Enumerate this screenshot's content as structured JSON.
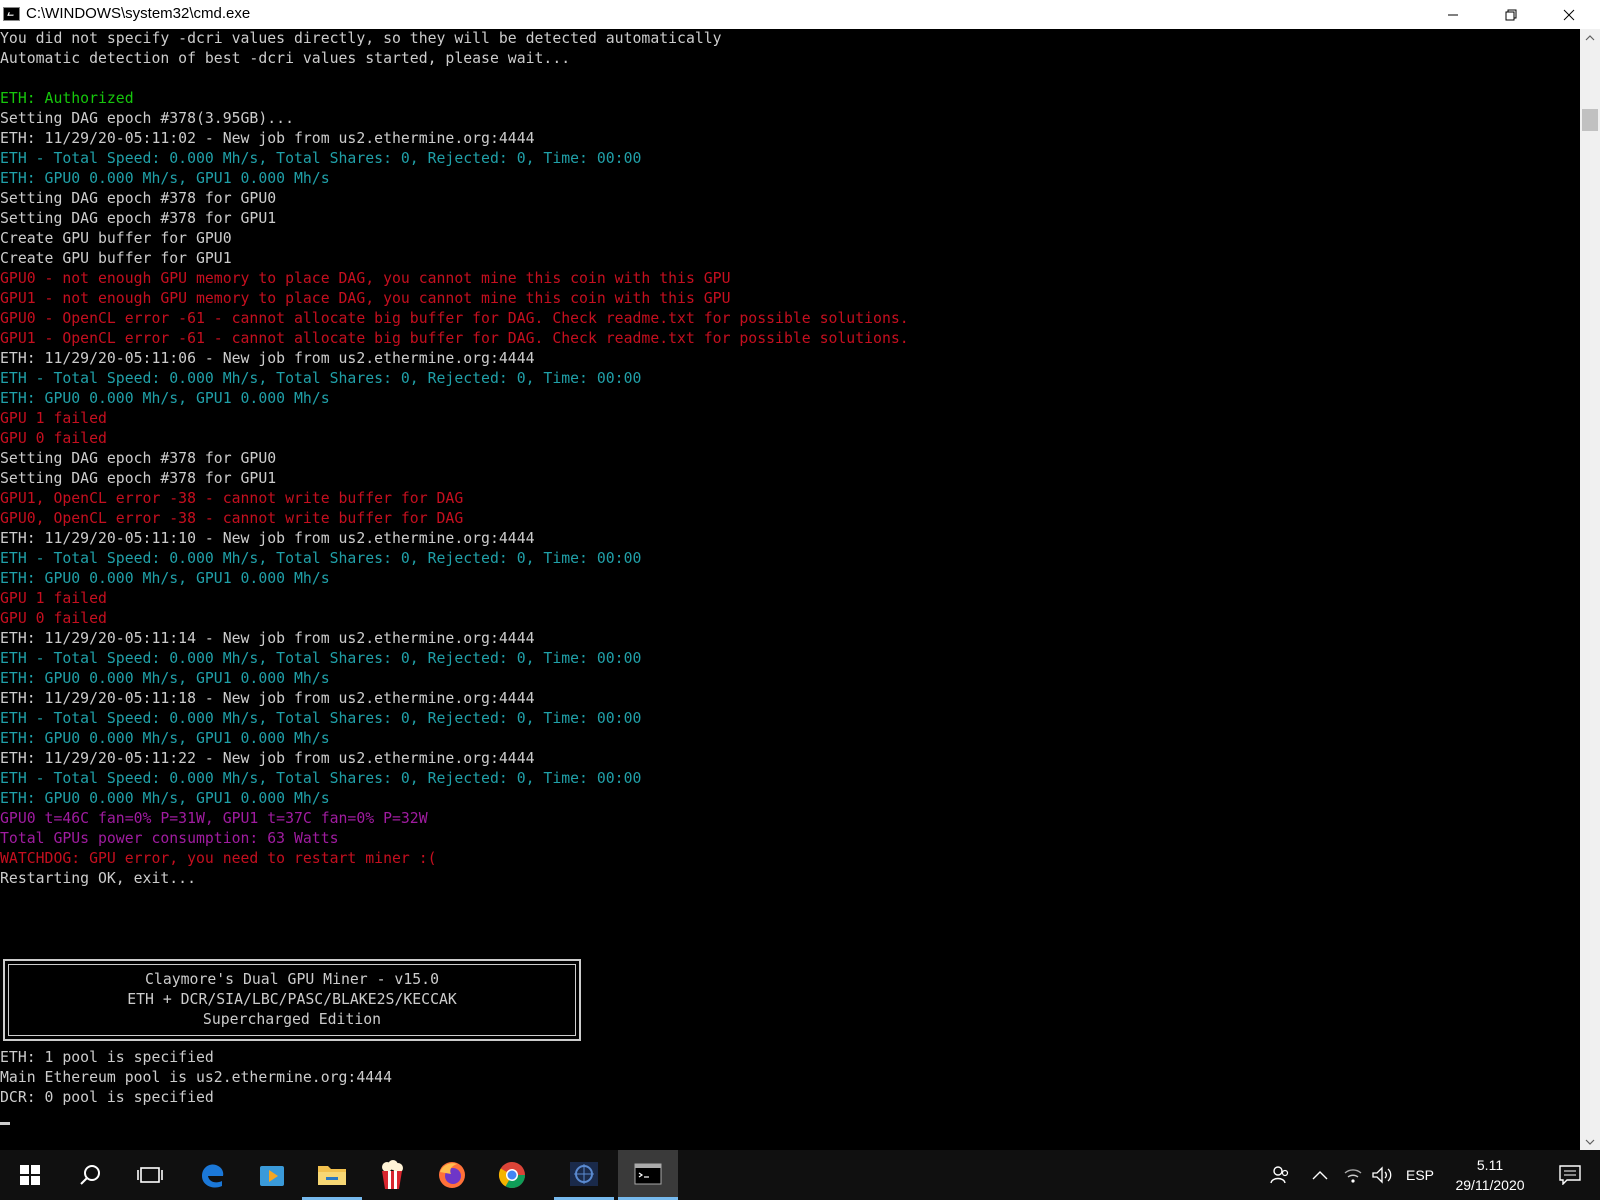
{
  "window": {
    "title": "C:\\WINDOWS\\system32\\cmd.exe",
    "icon": "cmd-icon",
    "controls": [
      "minimize-icon",
      "restore-icon",
      "close-icon"
    ]
  },
  "console": {
    "lines": [
      {
        "text": "You did not specify -dcri values directly, so they will be detected automatically",
        "color": "white"
      },
      {
        "text": "Automatic detection of best -dcri values started, please wait...",
        "color": "white"
      },
      {
        "text": "",
        "color": "white"
      },
      {
        "text": "ETH: Authorized",
        "color": "green"
      },
      {
        "text": "Setting DAG epoch #378(3.95GB)...",
        "color": "white"
      },
      {
        "text": "ETH: 11/29/20-05:11:02 - New job from us2.ethermine.org:4444",
        "color": "white"
      },
      {
        "text": "ETH - Total Speed: 0.000 Mh/s, Total Shares: 0, Rejected: 0, Time: 00:00",
        "color": "cyan"
      },
      {
        "text": "ETH: GPU0 0.000 Mh/s, GPU1 0.000 Mh/s",
        "color": "cyan"
      },
      {
        "text": "Setting DAG epoch #378 for GPU0",
        "color": "white"
      },
      {
        "text": "Setting DAG epoch #378 for GPU1",
        "color": "white"
      },
      {
        "text": "Create GPU buffer for GPU0",
        "color": "white"
      },
      {
        "text": "Create GPU buffer for GPU1",
        "color": "white"
      },
      {
        "text": "GPU0 - not enough GPU memory to place DAG, you cannot mine this coin with this GPU",
        "color": "red"
      },
      {
        "text": "GPU1 - not enough GPU memory to place DAG, you cannot mine this coin with this GPU",
        "color": "red"
      },
      {
        "text": "GPU0 - OpenCL error -61 - cannot allocate big buffer for DAG. Check readme.txt for possible solutions.",
        "color": "red"
      },
      {
        "text": "GPU1 - OpenCL error -61 - cannot allocate big buffer for DAG. Check readme.txt for possible solutions.",
        "color": "red"
      },
      {
        "text": "ETH: 11/29/20-05:11:06 - New job from us2.ethermine.org:4444",
        "color": "white"
      },
      {
        "text": "ETH - Total Speed: 0.000 Mh/s, Total Shares: 0, Rejected: 0, Time: 00:00",
        "color": "cyan"
      },
      {
        "text": "ETH: GPU0 0.000 Mh/s, GPU1 0.000 Mh/s",
        "color": "cyan"
      },
      {
        "text": "GPU 1 failed",
        "color": "red"
      },
      {
        "text": "GPU 0 failed",
        "color": "red"
      },
      {
        "text": "Setting DAG epoch #378 for GPU0",
        "color": "white"
      },
      {
        "text": "Setting DAG epoch #378 for GPU1",
        "color": "white"
      },
      {
        "text": "GPU1, OpenCL error -38 - cannot write buffer for DAG",
        "color": "red"
      },
      {
        "text": "GPU0, OpenCL error -38 - cannot write buffer for DAG",
        "color": "red"
      },
      {
        "text": "ETH: 11/29/20-05:11:10 - New job from us2.ethermine.org:4444",
        "color": "white"
      },
      {
        "text": "ETH - Total Speed: 0.000 Mh/s, Total Shares: 0, Rejected: 0, Time: 00:00",
        "color": "cyan"
      },
      {
        "text": "ETH: GPU0 0.000 Mh/s, GPU1 0.000 Mh/s",
        "color": "cyan"
      },
      {
        "text": "GPU 1 failed",
        "color": "red"
      },
      {
        "text": "GPU 0 failed",
        "color": "red"
      },
      {
        "text": "ETH: 11/29/20-05:11:14 - New job from us2.ethermine.org:4444",
        "color": "white"
      },
      {
        "text": "ETH - Total Speed: 0.000 Mh/s, Total Shares: 0, Rejected: 0, Time: 00:00",
        "color": "cyan"
      },
      {
        "text": "ETH: GPU0 0.000 Mh/s, GPU1 0.000 Mh/s",
        "color": "cyan"
      },
      {
        "text": "ETH: 11/29/20-05:11:18 - New job from us2.ethermine.org:4444",
        "color": "white"
      },
      {
        "text": "ETH - Total Speed: 0.000 Mh/s, Total Shares: 0, Rejected: 0, Time: 00:00",
        "color": "cyan"
      },
      {
        "text": "ETH: GPU0 0.000 Mh/s, GPU1 0.000 Mh/s",
        "color": "cyan"
      },
      {
        "text": "ETH: 11/29/20-05:11:22 - New job from us2.ethermine.org:4444",
        "color": "white"
      },
      {
        "text": "ETH - Total Speed: 0.000 Mh/s, Total Shares: 0, Rejected: 0, Time: 00:00",
        "color": "cyan"
      },
      {
        "text": "ETH: GPU0 0.000 Mh/s, GPU1 0.000 Mh/s",
        "color": "cyan"
      },
      {
        "text": "GPU0 t=46C fan=0% P=31W, GPU1 t=37C fan=0% P=32W",
        "color": "magenta"
      },
      {
        "text": "Total GPUs power consumption: 63 Watts",
        "color": "magenta"
      },
      {
        "text": "WATCHDOG: GPU error, you need to restart miner :(",
        "color": "red"
      },
      {
        "text": "Restarting OK, exit...",
        "color": "white"
      }
    ],
    "banner": [
      "Claymore's Dual GPU Miner - v15.0",
      "ETH + DCR/SIA/LBC/PASC/BLAKE2S/KECCAK",
      "Supercharged Edition"
    ],
    "after_banner": [
      {
        "text": "ETH: 1 pool is specified",
        "color": "white"
      },
      {
        "text": "Main Ethereum pool is us2.ethermine.org:4444",
        "color": "white"
      },
      {
        "text": "DCR: 0 pool is specified",
        "color": "white"
      }
    ]
  },
  "colors": {
    "white": "#cccccc",
    "green": "#16c60c",
    "cyan": "#20a0a8",
    "red": "#c50f1f",
    "magenta": "#a01ca0",
    "taskbar": "#101010",
    "accent": "#76b9ed"
  },
  "taskbar": {
    "apps": [
      "start-windows-icon",
      "search-icon",
      "task-view-icon",
      "edge-icon",
      "media-player-icon",
      "file-explorer-icon",
      "popcorn-icon",
      "firefox-icon",
      "chrome-icon",
      "miner-app-icon",
      "cmd-icon"
    ],
    "tray": {
      "language": "ESP",
      "time": "5.11",
      "date": "29/11/2020"
    }
  }
}
